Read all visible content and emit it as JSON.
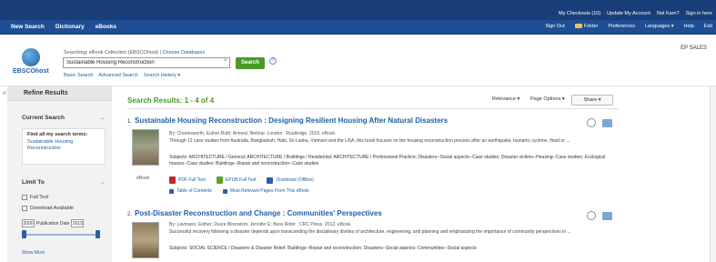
{
  "topbar": {
    "links": [
      "My Checkouts (10)",
      "Update My Account",
      "Not Karn?",
      "Sign in here"
    ]
  },
  "nav": {
    "left": [
      "New Search",
      "Dictionary",
      "eBooks"
    ],
    "right": [
      "Sign Out",
      "Folder",
      "Preferences",
      "Languages ▾",
      "Help",
      "Exit"
    ]
  },
  "search": {
    "searching_prefix": "Searching: eBook Collection (EBSCOhost)",
    "choose_db": "Choose Databases",
    "query": "Sustainable Housing Reconstruction",
    "button": "Search",
    "links": [
      "Basic Search",
      "Advanced Search",
      "Search History ▾"
    ],
    "logo_text": "EBSCOhost",
    "help_glyph": "?",
    "clear_glyph": "×"
  },
  "ep_sales": "EP SALES",
  "sidebar": {
    "title": "Refine Results",
    "current_search": "Current Search",
    "find_label": "Find all my search terms:",
    "find_terms": "Sustainable Housing Reconstruction",
    "limit_to": "Limit To",
    "full_text": "Full Text",
    "download_available": "Download Available",
    "date_from": "2000",
    "date_label": "Publication Date",
    "date_to": "2015",
    "show_more": "Show More"
  },
  "results": {
    "header": "Search Results: 1 - 4 of 4",
    "relevance": "Relevance ▾",
    "page_options": "Page Options ▾",
    "share": "Share ▾",
    "items": [
      {
        "num": "1.",
        "title_a": "Sustainable Housing Reconstruction",
        "title_b": "Designing Resilient Housing After Natural Disasters",
        "byline": "By: Charlesworth, Esther Ruth; Ahmed, Iftekhar. London : Routledge. 2015. eBook.",
        "abstract": "Through 12 case studies from Australia, Bangladesh, Haiti, Sri Lanka, Vietnam and the USA, this book focuses on the housing reconstruction process after an earthquake, tsunami, cyclone, flood or ...",
        "subjects": "Subjects: ARCHITECTURE / General; ARCHITECTURE / Buildings / Residential; ARCHITECTURE / Professional Practice; Disasters--Social aspects--Case studies; Disaster victims--Housing--Case studies; Ecological houses--Case studies; Buildings--Repair and reconstruction--Case studies",
        "cover_label": "eBook",
        "pdf": "PDF Full Text",
        "epub": "EPUB Full Text",
        "download": "Download (Offline)",
        "toc": "Table of Contents",
        "relevant": "Most Relevant Pages From This eBook"
      },
      {
        "num": "2.",
        "title_a": "Post-Disaster Reconstruction and Change",
        "title_b": "Communities' Perspectives",
        "byline": "By: Lavmann, Esther; Dusre Blrenslom, Jennifer E; Bess Rotor . CRC Press. 2012. eBook.",
        "abstract": "Successful recovery following a disaster depends upon transcending the disciplinary divides of architecture, engineering, and planning and emphasizing the importance of community perspectives in ...",
        "subjects": "Subjects: SOCIAL SCIENCE / Disasters & Disaster Relief; Buildings--Repair and reconstruction; Disasters--Social aspects; Communities--Social aspects"
      }
    ]
  },
  "colors": {
    "topbar": "#1a3e7a",
    "navbar": "#1f4e95",
    "results_header": "#4a9a2a",
    "link": "#1f5fa8"
  }
}
